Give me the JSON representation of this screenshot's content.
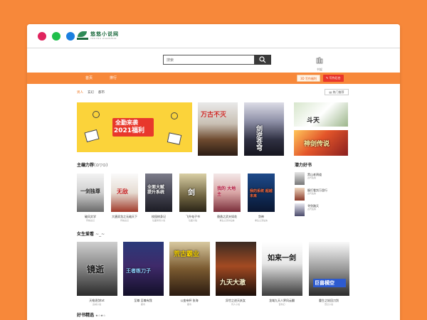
{
  "colors": {
    "accent": "#f7883a",
    "red_btn": "#e8352c",
    "active_tab": "#f07a25"
  },
  "logo": {
    "name": "悠悠小说网",
    "sub": "YOUYOU XIAOSHUO"
  },
  "search": {
    "placeholder": "搜索"
  },
  "shelf": {
    "label": "书架",
    "icon": "bookshelf-icon"
  },
  "nav": {
    "home": "首页",
    "rank": "排行",
    "write_benefit": "写作福利",
    "write_benefit_tag": "3D",
    "write_backend": "写作后台"
  },
  "subnav": {
    "items": [
      "男人",
      "玄幻",
      "都市"
    ],
    "top_link": "热门推荐"
  },
  "banner": {
    "line1": "全勤来袭",
    "line2": "2021福利"
  },
  "featured": [
    {
      "title": "万古不灭"
    },
    {
      "title": "剑逆苍穹"
    }
  ],
  "sections": {
    "editor": {
      "title": "主编力荐",
      "tail": "(⊙▽⊙)"
    },
    "girls": {
      "title": "女生爱看",
      "tail": "~_~"
    },
    "latent": {
      "title": "潜力好书"
    },
    "fine": {
      "title": "好书精选",
      "tail": "★☆★☆"
    }
  },
  "editor_books": [
    {
      "cover": "一剑独尊",
      "name": "破风文学",
      "author": "传统玄幻"
    },
    {
      "cover": "无敌",
      "name": "大唐双龙之无敌天下",
      "author": "传统玄幻"
    },
    {
      "cover": "全面大赋 提升系统",
      "name": "校园修身记",
      "author": "位面修真小说"
    },
    {
      "cover": "剑",
      "name": "飞升电子书",
      "author": "位面大陆"
    },
    {
      "cover": "我的 大地主",
      "name": "聂逸之武夫如花",
      "author": "重生之流书仙侠"
    },
    {
      "cover": "我的系统 超越未来",
      "name": "剑神",
      "author": "重生之流仙侠"
    }
  ],
  "girls_books": [
    {
      "cover": "镜逝",
      "name": "天枪逐剑txt",
      "author": "边城小说"
    },
    {
      "cover": "王者练刀子",
      "name": "至尊 至尊有我",
      "author": "都市"
    },
    {
      "cover": "荒古霸业",
      "name": "公变帝杯 张海",
      "author": "都市"
    },
    {
      "cover": "九天大澈",
      "name": "异世之逆天妖女",
      "author": "同人小说"
    },
    {
      "cover": "如来一剑",
      "name": "龙域九天人界风云翻",
      "author": "百科幻"
    },
    {
      "cover": "巨兽横空",
      "name": "重生之轮回刀剑",
      "author": "奇幻小说"
    }
  ],
  "latent_books": [
    {
      "name": "黑山老鸦道",
      "sub": "古代仙侠"
    },
    {
      "name": "握灯看剑万里行",
      "sub": "古代仙侠"
    },
    {
      "name": "寻剑路天",
      "sub": "古代仙侠"
    }
  ],
  "right_covers": [
    {
      "title": "斗天"
    },
    {
      "title": "神剑传说"
    }
  ]
}
